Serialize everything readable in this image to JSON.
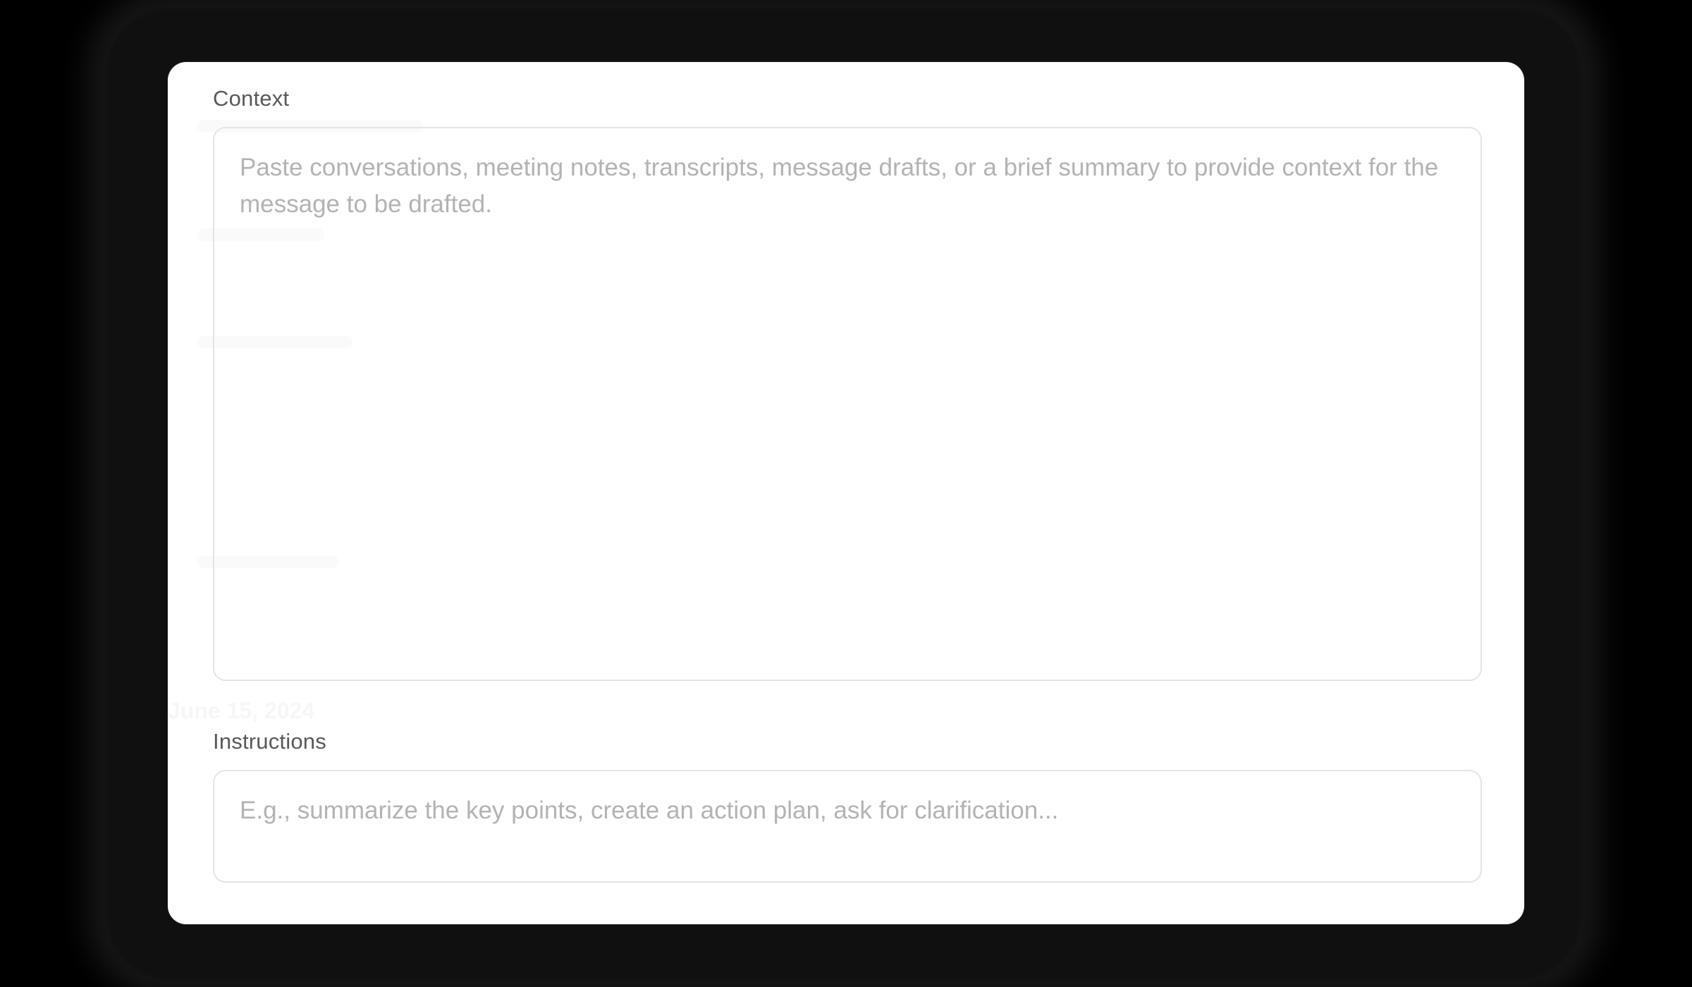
{
  "form": {
    "context": {
      "label": "Context",
      "value": "",
      "placeholder": "Paste conversations, meeting notes, transcripts, message drafts, or a brief summary to provide context for the message to be drafted."
    },
    "instructions": {
      "label": "Instructions",
      "value": "",
      "placeholder": "E.g., summarize the key points, create an action plan, ask for clarification..."
    }
  },
  "background": {
    "faint_date": "June 15, 2024"
  }
}
